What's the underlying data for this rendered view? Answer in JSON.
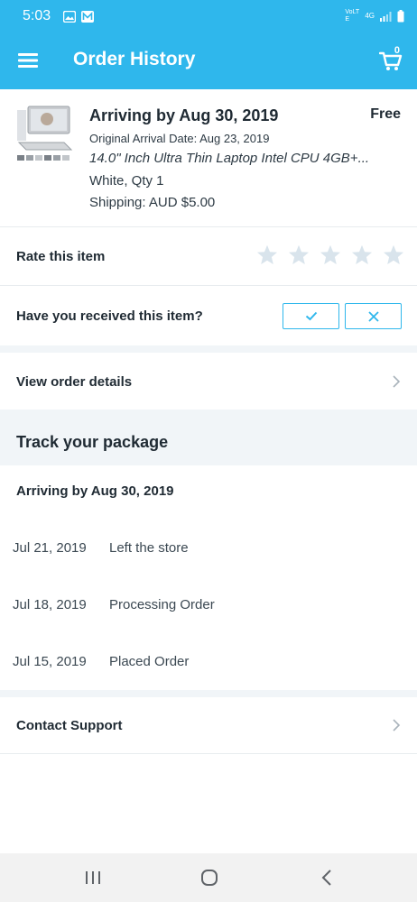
{
  "status_bar": {
    "time": "5:03",
    "network": "4G",
    "volte": "VoLTE"
  },
  "app_bar": {
    "title": "Order History",
    "cart_count": "0"
  },
  "product": {
    "arrival_title": "Arriving by Aug 30, 2019",
    "price_label": "Free",
    "original_arrival": "Original Arrival Date: Aug 23, 2019",
    "name": "14.0\" Inch Ultra Thin Laptop Intel CPU 4GB+...",
    "variant": "White, Qty 1",
    "shipping": "Shipping: AUD $5.00"
  },
  "rate": {
    "label": "Rate this item",
    "stars_total": 5,
    "stars_filled": 0
  },
  "received": {
    "label": "Have you received this item?"
  },
  "view_order": {
    "label": "View order details"
  },
  "tracking": {
    "heading": "Track your package",
    "arriving": "Arriving by Aug 30, 2019",
    "events": [
      {
        "date": "Jul 21, 2019",
        "text": "Left the store"
      },
      {
        "date": "Jul 18, 2019",
        "text": "Processing Order"
      },
      {
        "date": "Jul 15, 2019",
        "text": "Placed Order"
      }
    ]
  },
  "support": {
    "label": "Contact Support"
  },
  "colors": {
    "accent": "#2fb7ec",
    "star": "#d9e4ec",
    "band": "#f1f5f8"
  }
}
